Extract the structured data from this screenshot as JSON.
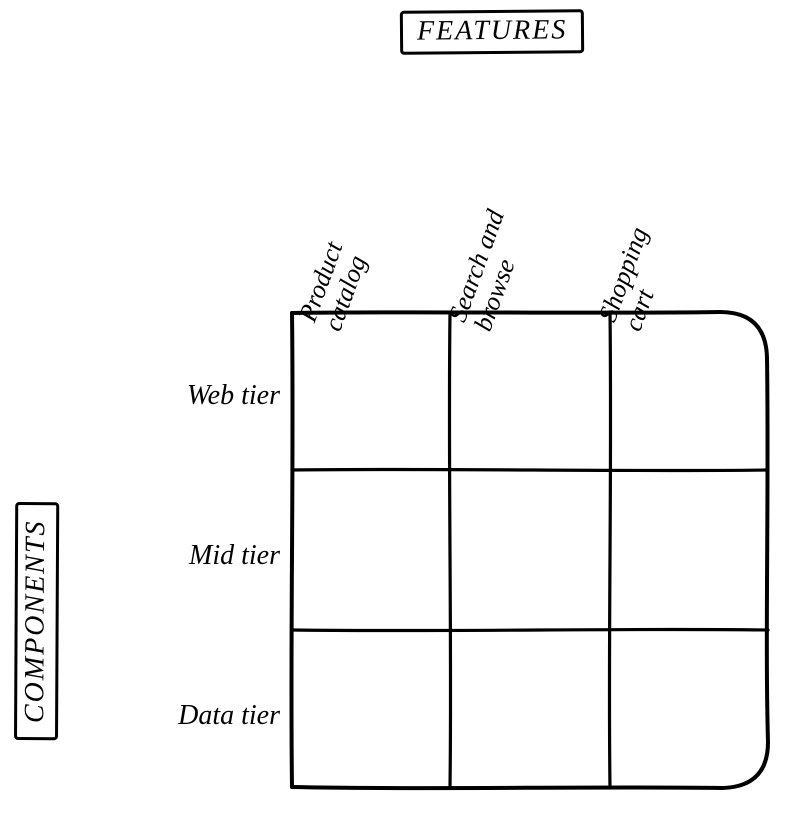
{
  "titles": {
    "features": "FEATURES",
    "components": "COMPONENTS"
  },
  "features": [
    "Product\ncatalog",
    "Search and\nbrowse",
    "Shopping\ncart"
  ],
  "components": [
    "Web tier",
    "Mid tier",
    "Data tier"
  ],
  "chart_data": {
    "type": "table",
    "title": "Features × Components matrix",
    "columns": [
      "Product catalog",
      "Search and browse",
      "Shopping cart"
    ],
    "rows": [
      "Web tier",
      "Mid tier",
      "Data tier"
    ],
    "cells": [
      [
        "",
        "",
        ""
      ],
      [
        "",
        "",
        ""
      ],
      [
        "",
        "",
        ""
      ]
    ]
  }
}
